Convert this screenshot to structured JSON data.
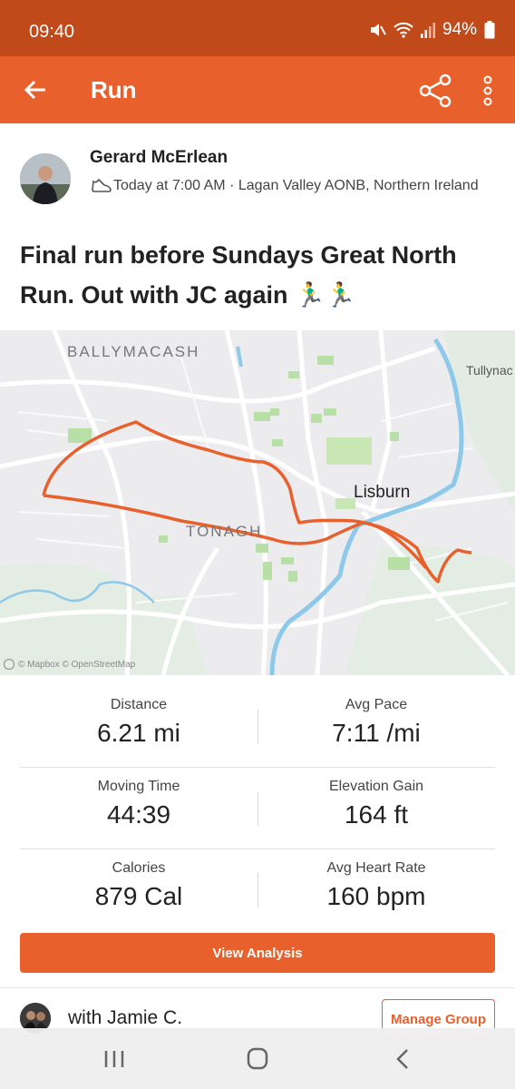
{
  "status_bar": {
    "time": "09:40",
    "battery": "94%"
  },
  "app_bar": {
    "title": "Run"
  },
  "activity": {
    "athlete_name": "Gerard McErlean",
    "meta": "Today at 7:00 AM · Lagan Valley AONB, Northern Ireland",
    "title": "Final run before Sundays Great North Run. Out with JC again 🏃‍♂️🏃‍♂️"
  },
  "map": {
    "labels": {
      "ballymacash": "BALLYMACASH",
      "tullynacross": "Tullynac",
      "lisburn": "Lisburn",
      "tonagh": "TONAGH"
    },
    "attribution": "© Mapbox © OpenStreetMap"
  },
  "stats": [
    {
      "left": {
        "label": "Distance",
        "value": "6.21 mi"
      },
      "right": {
        "label": "Avg Pace",
        "value": "7:11 /mi"
      }
    },
    {
      "left": {
        "label": "Moving Time",
        "value": "44:39"
      },
      "right": {
        "label": "Elevation Gain",
        "value": "164 ft"
      }
    },
    {
      "left": {
        "label": "Calories",
        "value": "879 Cal"
      },
      "right": {
        "label": "Avg Heart Rate",
        "value": "160 bpm"
      }
    }
  ],
  "view_analysis_label": "View Analysis",
  "group": {
    "text": "with Jamie C.",
    "button_label": "Manage Group"
  },
  "colors": {
    "brand": "#e8602c",
    "status_bar": "#c14a1b",
    "route": "#e8602c",
    "river": "#8ec9ea"
  },
  "icons": [
    "back-arrow-icon",
    "share-icon",
    "more-vert-icon",
    "shoe-icon",
    "mute-icon",
    "wifi-icon",
    "signal-icon",
    "battery-icon",
    "recents-icon",
    "home-icon",
    "back-nav-icon"
  ]
}
